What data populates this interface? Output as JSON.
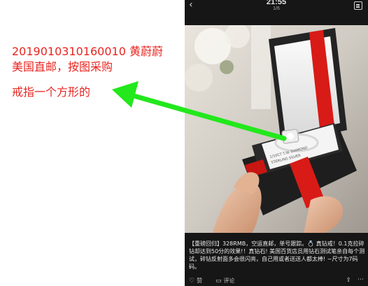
{
  "annotation": {
    "line1": "2019010310160010  黄蔚蔚",
    "line2": "美国直邮，按图采购",
    "line3": "戒指一个方形的",
    "text_color": "#e8241f",
    "arrow_color": "#22e81c"
  },
  "phone": {
    "status": {
      "time": "21:55",
      "pager": "1/6",
      "back_glyph": "‹"
    },
    "photo": {
      "box_label_line1": "1/10CT T.W. DIAMOND",
      "box_label_line2": "STERLING SILVER"
    },
    "caption": "【重磅回归】328RMB，空运直邮，单号跟踪。💍 真钻戒！0.1克拉碎钻却达到50分的效果!！真钻石! 美国百货店员用钻石测试笔亲自每个测试，碎钻反射面多会很闪亮，自己用或者送送人都太棒! ~尺寸为7码码。",
    "actions": {
      "like_label": "赞",
      "comment_label": "评论",
      "like_glyph": "♡",
      "comment_glyph": "▭",
      "share_glyph": "⇪",
      "more_glyph": "⋯"
    }
  }
}
